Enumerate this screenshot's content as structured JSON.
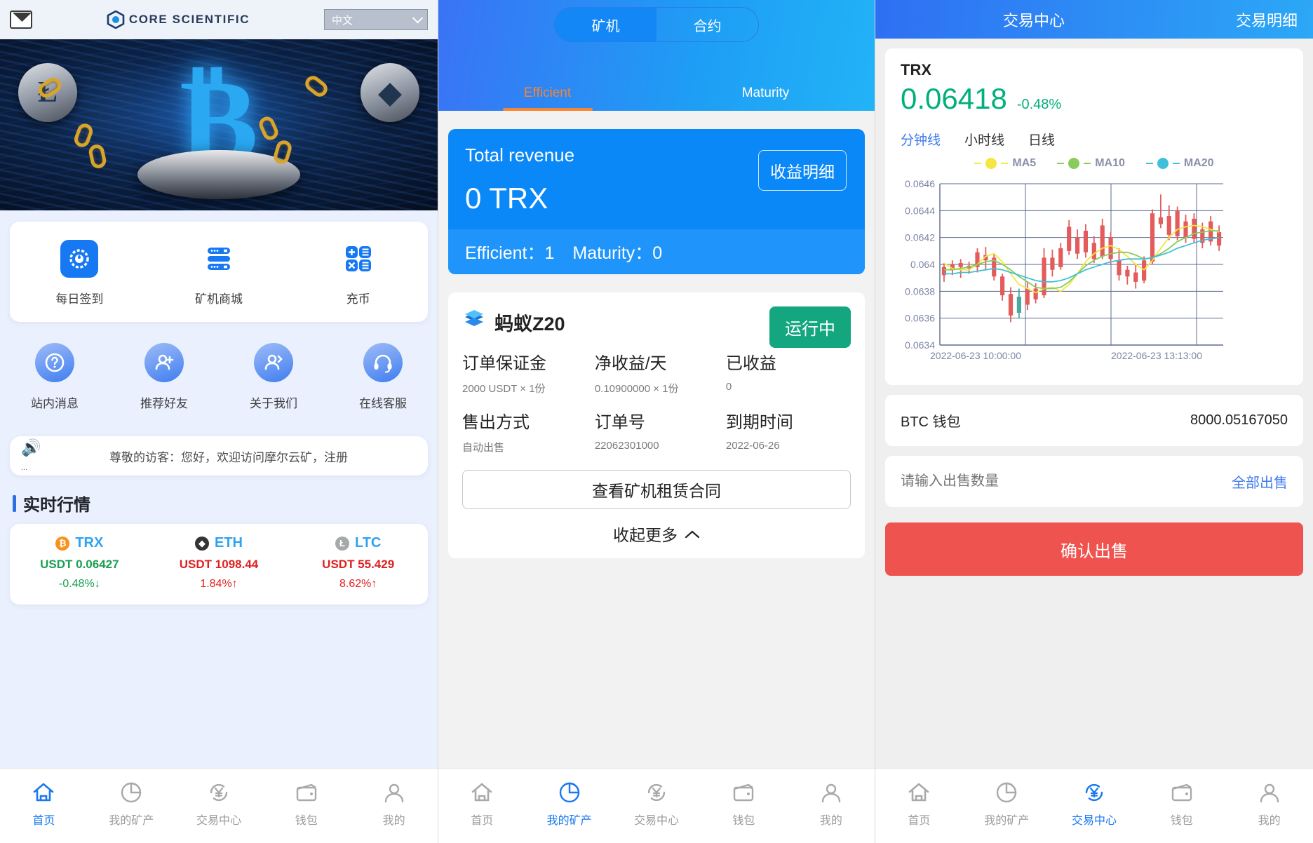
{
  "panel_home": {
    "topbar": {
      "mail_icon": "mail-icon",
      "brand": "CORE SCIENTIFIC",
      "brand_sup": "®",
      "language": "中文"
    },
    "banner": {
      "alt": "bitcoin-chain-banner",
      "symbols": [
        "Ł",
        "B",
        "◆"
      ]
    },
    "quick_actions": [
      {
        "label": "每日签到",
        "icon": "checkin-icon"
      },
      {
        "label": "矿机商城",
        "icon": "server-shop-icon"
      },
      {
        "label": "充币",
        "icon": "deposit-icon"
      }
    ],
    "secondary_actions": [
      {
        "label": "站内消息",
        "icon": "question-message-icon"
      },
      {
        "label": "推荐好友",
        "icon": "user-add-icon"
      },
      {
        "label": "关于我们",
        "icon": "user-info-icon"
      },
      {
        "label": "在线客服",
        "icon": "headset-support-icon"
      }
    ],
    "notice": {
      "icon": "speaker-icon",
      "dots": "...",
      "text": "尊敬的访客：您好，欢迎访问摩尔云矿，注册"
    },
    "market_title": "实时行情",
    "market": [
      {
        "symbol": "TRX",
        "badge": "₿",
        "badge_color": "#f7931a",
        "price": "USDT 0.06427",
        "change": "-0.48%",
        "dir": "down",
        "color": "#1a9e52"
      },
      {
        "symbol": "ETH",
        "badge": "◆",
        "badge_color": "#343434",
        "price": "USDT 1098.44",
        "change": "1.84%",
        "dir": "up",
        "color": "#e02020"
      },
      {
        "symbol": "LTC",
        "badge": "Ł",
        "badge_color": "#a6a9aa",
        "price": "USDT 55.429",
        "change": "8.62%",
        "dir": "up",
        "color": "#e02020"
      }
    ],
    "tabs": [
      {
        "label": "首页",
        "icon": "home-icon",
        "active": true
      },
      {
        "label": "我的矿产",
        "icon": "pie-chart-icon",
        "active": false
      },
      {
        "label": "交易中心",
        "icon": "yuan-exchange-icon",
        "active": false
      },
      {
        "label": "钱包",
        "icon": "wallet-icon",
        "active": false
      },
      {
        "label": "我的",
        "icon": "user-icon",
        "active": false
      }
    ]
  },
  "panel_mining": {
    "segments": [
      {
        "label": "矿机",
        "active": true
      },
      {
        "label": "合约",
        "active": false
      }
    ],
    "subtabs": [
      {
        "label": "Efficient",
        "active": true
      },
      {
        "label": "Maturity",
        "active": false
      }
    ],
    "revenue": {
      "label": "Total revenue",
      "amount": "0 TRX",
      "detail_button": "收益明细",
      "efficient_label": "Efficient：",
      "efficient_value": "1",
      "maturity_label": "Maturity：",
      "maturity_value": "0"
    },
    "machine": {
      "icon": "stacked-layers-icon",
      "name": "蚂蚁Z20",
      "status": "运行中",
      "fields": [
        {
          "head": "订单保证金",
          "value": "2000 USDT × 1份"
        },
        {
          "head": "净收益/天",
          "value": "0.10900000 × 1份"
        },
        {
          "head": "已收益",
          "value": "0"
        },
        {
          "head": "售出方式",
          "value": "自动出售"
        },
        {
          "head": "订单号",
          "value": "22062301000"
        },
        {
          "head": "到期时间",
          "value": "2022-06-26"
        }
      ],
      "contract_button": "查看矿机租赁合同",
      "collapse_label": "收起更多",
      "collapse_icon": "chevron-up-icon"
    },
    "tabs": [
      {
        "label": "首页",
        "icon": "home-icon",
        "active": false
      },
      {
        "label": "我的矿产",
        "icon": "pie-chart-icon",
        "active": true
      },
      {
        "label": "交易中心",
        "icon": "yuan-exchange-icon",
        "active": false
      },
      {
        "label": "钱包",
        "icon": "wallet-icon",
        "active": false
      },
      {
        "label": "我的",
        "icon": "user-icon",
        "active": false
      }
    ]
  },
  "panel_trade": {
    "header": {
      "left": "交易中心",
      "right": "交易明细"
    },
    "quote": {
      "symbol": "TRX",
      "price": "0.06418",
      "change": "-0.48%"
    },
    "interval_tabs": [
      {
        "label": "分钟线",
        "active": true
      },
      {
        "label": "小时线",
        "active": false
      },
      {
        "label": "日线",
        "active": false
      }
    ],
    "wallet_row": {
      "label": "BTC 钱包",
      "value": "8000.05167050"
    },
    "sell_row": {
      "placeholder": "请输入出售数量",
      "action": "全部出售"
    },
    "confirm_button": "确认出售",
    "tabs": [
      {
        "label": "首页",
        "icon": "home-icon",
        "active": false
      },
      {
        "label": "我的矿产",
        "icon": "pie-chart-icon",
        "active": false
      },
      {
        "label": "交易中心",
        "icon": "yuan-exchange-icon",
        "active": true
      },
      {
        "label": "钱包",
        "icon": "wallet-icon",
        "active": false
      },
      {
        "label": "我的",
        "icon": "user-icon",
        "active": false
      }
    ]
  },
  "chart_data": {
    "type": "candlestick",
    "title": "TRX 分钟线",
    "xlabel": "",
    "ylabel": "",
    "ylim": [
      0.0634,
      0.0646
    ],
    "yticks": [
      "0.0634",
      "0.0636",
      "0.0638",
      "0.064",
      "0.0642",
      "0.0644",
      "0.0646"
    ],
    "xticks": [
      "2022-06-23 10:00:00",
      "2022-06-23 13:13:00"
    ],
    "grid": true,
    "legend_position": "top-center",
    "legend": [
      {
        "name": "MA5",
        "color": "#f5e642"
      },
      {
        "name": "MA10",
        "color": "#87cc5c"
      },
      {
        "name": "MA20",
        "color": "#3fc0d8"
      }
    ],
    "up_color": "#e35b5b",
    "down_color": "#4aa8a0",
    "candles": [
      {
        "o": 0.06392,
        "h": 0.06401,
        "l": 0.06387,
        "c": 0.06398,
        "d": "up"
      },
      {
        "o": 0.06396,
        "h": 0.06403,
        "l": 0.06392,
        "c": 0.064,
        "d": "up"
      },
      {
        "o": 0.06398,
        "h": 0.06404,
        "l": 0.0639,
        "c": 0.06401,
        "d": "up"
      },
      {
        "o": 0.06397,
        "h": 0.06402,
        "l": 0.06393,
        "c": 0.06399,
        "d": "up"
      },
      {
        "o": 0.06398,
        "h": 0.06412,
        "l": 0.06394,
        "c": 0.06409,
        "d": "up"
      },
      {
        "o": 0.06403,
        "h": 0.06413,
        "l": 0.06396,
        "c": 0.06407,
        "d": "up"
      },
      {
        "o": 0.06405,
        "h": 0.06408,
        "l": 0.06388,
        "c": 0.06391,
        "d": "up"
      },
      {
        "o": 0.06391,
        "h": 0.06393,
        "l": 0.06373,
        "c": 0.06377,
        "d": "up"
      },
      {
        "o": 0.06378,
        "h": 0.06383,
        "l": 0.06357,
        "c": 0.06362,
        "d": "up"
      },
      {
        "o": 0.06364,
        "h": 0.06382,
        "l": 0.0636,
        "c": 0.06376,
        "d": "down"
      },
      {
        "o": 0.0637,
        "h": 0.06387,
        "l": 0.06366,
        "c": 0.06382,
        "d": "up"
      },
      {
        "o": 0.06382,
        "h": 0.06386,
        "l": 0.06371,
        "c": 0.06374,
        "d": "up"
      },
      {
        "o": 0.06377,
        "h": 0.06412,
        "l": 0.06375,
        "c": 0.06405,
        "d": "up"
      },
      {
        "o": 0.06405,
        "h": 0.06411,
        "l": 0.06391,
        "c": 0.06396,
        "d": "up"
      },
      {
        "o": 0.06398,
        "h": 0.06416,
        "l": 0.06396,
        "c": 0.06412,
        "d": "up"
      },
      {
        "o": 0.0641,
        "h": 0.06433,
        "l": 0.06407,
        "c": 0.06428,
        "d": "up"
      },
      {
        "o": 0.0642,
        "h": 0.06426,
        "l": 0.06404,
        "c": 0.06408,
        "d": "up"
      },
      {
        "o": 0.06409,
        "h": 0.0643,
        "l": 0.06405,
        "c": 0.06425,
        "d": "up"
      },
      {
        "o": 0.06416,
        "h": 0.06421,
        "l": 0.06401,
        "c": 0.06404,
        "d": "up"
      },
      {
        "o": 0.06406,
        "h": 0.06434,
        "l": 0.06404,
        "c": 0.06429,
        "d": "up"
      },
      {
        "o": 0.0642,
        "h": 0.06424,
        "l": 0.064,
        "c": 0.06404,
        "d": "up"
      },
      {
        "o": 0.06403,
        "h": 0.06412,
        "l": 0.06388,
        "c": 0.06392,
        "d": "up"
      },
      {
        "o": 0.06391,
        "h": 0.06399,
        "l": 0.06385,
        "c": 0.06396,
        "d": "up"
      },
      {
        "o": 0.06394,
        "h": 0.064,
        "l": 0.06382,
        "c": 0.06387,
        "d": "up"
      },
      {
        "o": 0.06388,
        "h": 0.06406,
        "l": 0.06386,
        "c": 0.06403,
        "d": "up"
      },
      {
        "o": 0.06402,
        "h": 0.06441,
        "l": 0.064,
        "c": 0.06438,
        "d": "up"
      },
      {
        "o": 0.0643,
        "h": 0.06452,
        "l": 0.06427,
        "c": 0.06435,
        "d": "up"
      },
      {
        "o": 0.06436,
        "h": 0.06444,
        "l": 0.06418,
        "c": 0.06422,
        "d": "up"
      },
      {
        "o": 0.06421,
        "h": 0.06443,
        "l": 0.06418,
        "c": 0.0644,
        "d": "up"
      },
      {
        "o": 0.06432,
        "h": 0.06437,
        "l": 0.06416,
        "c": 0.0642,
        "d": "up"
      },
      {
        "o": 0.06419,
        "h": 0.06438,
        "l": 0.06416,
        "c": 0.06434,
        "d": "up"
      },
      {
        "o": 0.06426,
        "h": 0.06431,
        "l": 0.06412,
        "c": 0.06416,
        "d": "up"
      },
      {
        "o": 0.06417,
        "h": 0.06436,
        "l": 0.06414,
        "c": 0.06432,
        "d": "up"
      },
      {
        "o": 0.06424,
        "h": 0.06429,
        "l": 0.0641,
        "c": 0.06414,
        "d": "up"
      }
    ],
    "ma5": [
      0.06401,
      0.06397,
      0.06396,
      0.06396,
      0.064,
      0.06406,
      0.06408,
      0.06402,
      0.06393,
      0.06385,
      0.06382,
      0.06379,
      0.06382,
      0.06383,
      0.0638,
      0.06385,
      0.06393,
      0.06402,
      0.06408,
      0.06412,
      0.06414,
      0.06411,
      0.06406,
      0.064,
      0.06396,
      0.06403,
      0.06412,
      0.0642,
      0.06426,
      0.06428,
      0.06429,
      0.06428,
      0.06426,
      0.06424
    ],
    "ma10": [
      0.06396,
      0.06396,
      0.06397,
      0.06398,
      0.064,
      0.06402,
      0.06403,
      0.064,
      0.06396,
      0.06391,
      0.06387,
      0.06383,
      0.06382,
      0.06382,
      0.06383,
      0.06387,
      0.06393,
      0.06399,
      0.06403,
      0.06406,
      0.06408,
      0.06409,
      0.06409,
      0.06407,
      0.06404,
      0.06405,
      0.06408,
      0.06412,
      0.06417,
      0.0642,
      0.06423,
      0.06424,
      0.06425,
      0.06425
    ],
    "ma20": [
      0.06393,
      0.06393,
      0.06394,
      0.06394,
      0.06395,
      0.06396,
      0.06397,
      0.06396,
      0.06394,
      0.06392,
      0.0639,
      0.06388,
      0.06387,
      0.06387,
      0.06388,
      0.0639,
      0.06393,
      0.06396,
      0.06398,
      0.064,
      0.06402,
      0.06403,
      0.06404,
      0.06404,
      0.06404,
      0.06405,
      0.06407,
      0.06409,
      0.06412,
      0.06414,
      0.06416,
      0.06418,
      0.06419,
      0.0642
    ]
  }
}
